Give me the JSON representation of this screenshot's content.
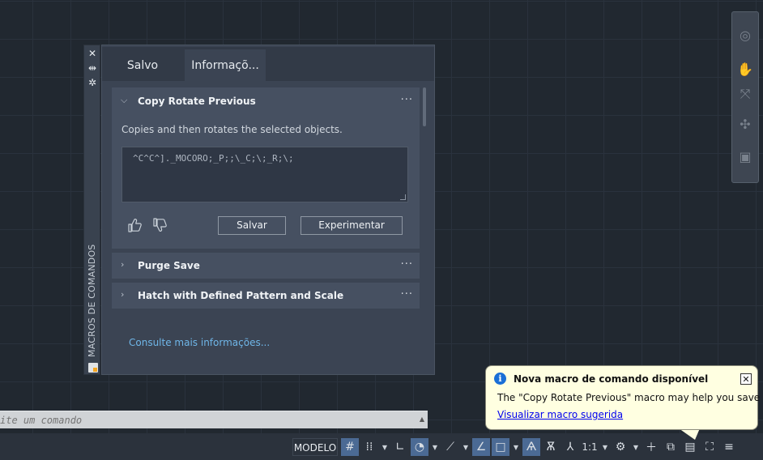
{
  "palette": {
    "vertical_title": "MACROS DE COMANDOS",
    "tabs": [
      {
        "label": "Salvo"
      },
      {
        "label": "Informaçõ..."
      }
    ],
    "expanded": {
      "title": "Copy Rotate Previous",
      "description": "Copies and then rotates the selected objects.",
      "macro": "^C^C^]._MOCORO;_P;;\\_C;\\;_R;\\;",
      "save_label": "Salvar",
      "try_label": "Experimentar",
      "menu": "···"
    },
    "items": [
      {
        "title": "Purge Save",
        "menu": "···"
      },
      {
        "title": "Hatch with Defined Pattern and Scale",
        "menu": "···"
      }
    ],
    "more_link": "Consulte mais informações..."
  },
  "command_line": {
    "placeholder": "ite um comando"
  },
  "status": {
    "modelo": "MODELO",
    "scale": "1:1"
  },
  "balloon": {
    "title": "Nova macro de comando disponível",
    "body": "The \"Copy Rotate Previous\" macro may help you save time",
    "link": "Visualizar macro sugerida"
  },
  "colors": {
    "link": "#6fb6e8",
    "accent": "#4b6a94",
    "balloon_bg": "#ffffe1"
  }
}
